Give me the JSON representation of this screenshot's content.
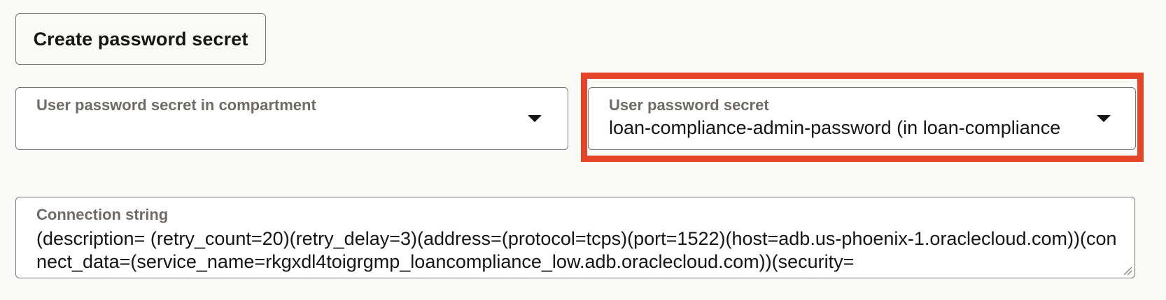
{
  "create_button": {
    "label": "Create password secret"
  },
  "compartment_select": {
    "label": "User password secret in compartment",
    "value": "",
    "icon": "chevron-down-icon"
  },
  "secret_select": {
    "label": "User password secret",
    "value": "loan-compliance-admin-password (in loan-compliance",
    "icon": "chevron-down-icon",
    "highlight_color": "#e5432a"
  },
  "connection_string": {
    "label": "Connection string",
    "value": "(description= (retry_count=20)(retry_delay=3)(address=(protocol=tcps)(port=1522)(host=adb.us-phoenix-1.oraclecloud.com))(connect_data=(service_name=rkgxdl4toigrgmp_loancompliance_low.adb.oraclecloud.com))(security=",
    "resize_icon": "resize-grip-icon"
  }
}
